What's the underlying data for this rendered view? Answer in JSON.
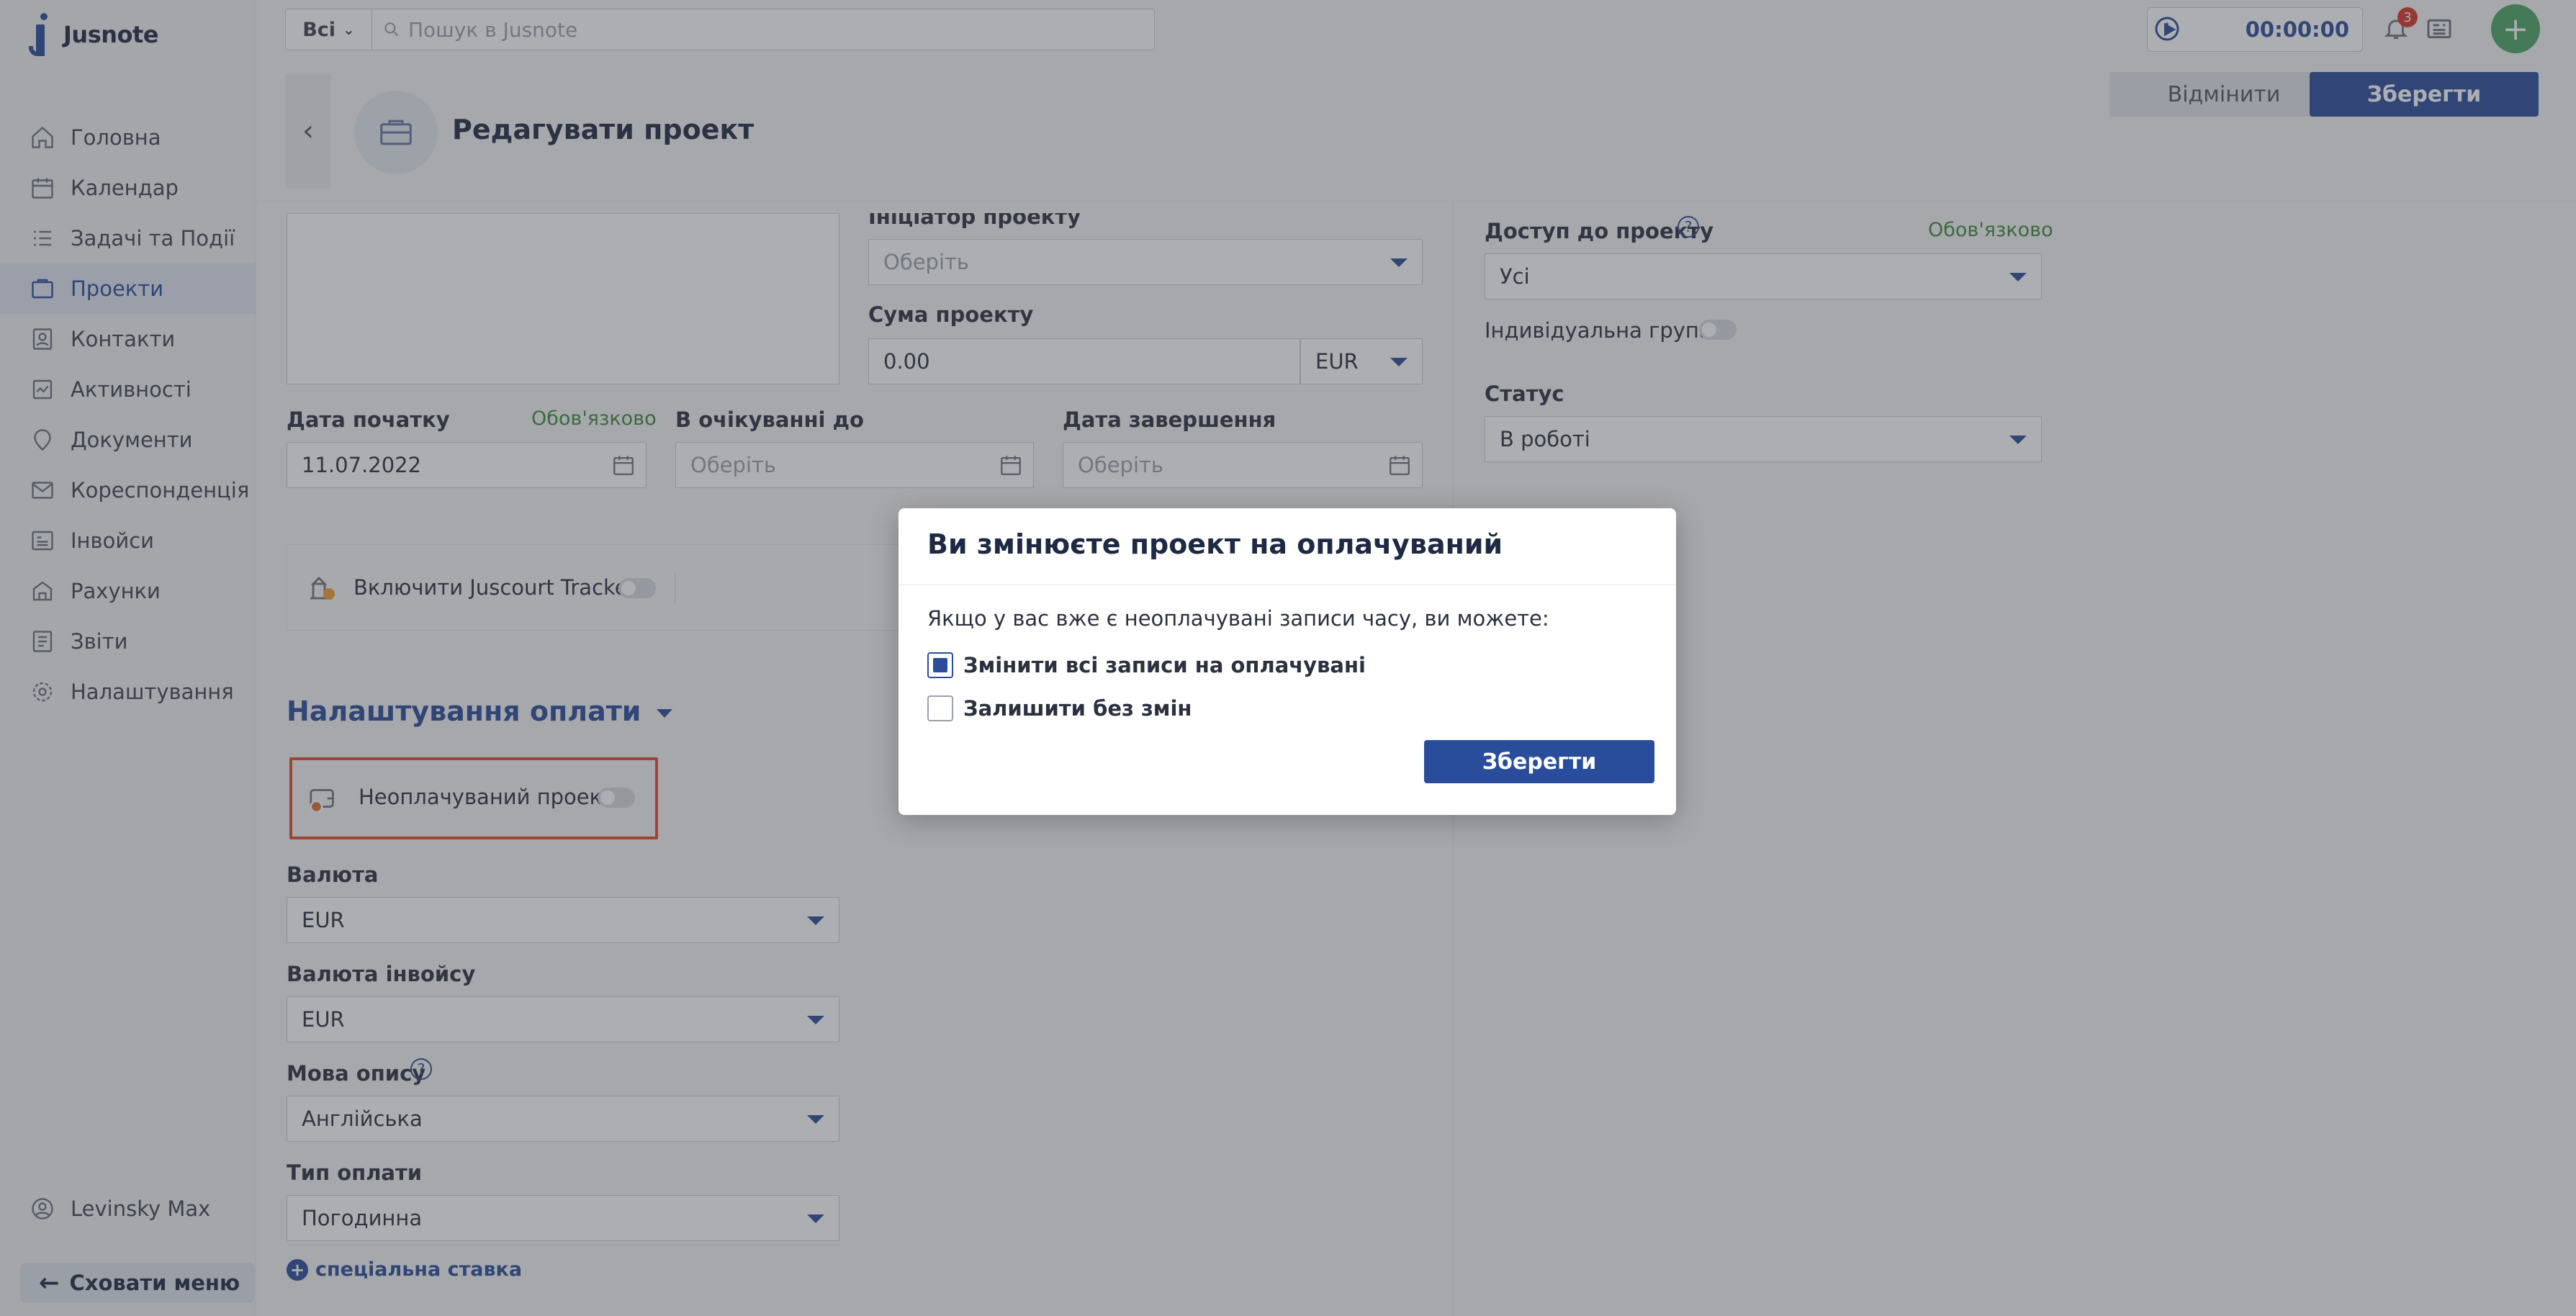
{
  "app": {
    "name": "Jusnote"
  },
  "sidebar": {
    "items": [
      {
        "label": "Головна",
        "icon": "home-icon"
      },
      {
        "label": "Календар",
        "icon": "calendar-icon"
      },
      {
        "label": "Задачі та Події",
        "icon": "tasks-icon"
      },
      {
        "label": "Проекти",
        "icon": "projects-icon",
        "active": true
      },
      {
        "label": "Контакти",
        "icon": "contacts-icon"
      },
      {
        "label": "Активності",
        "icon": "activities-icon"
      },
      {
        "label": "Документи",
        "icon": "documents-icon"
      },
      {
        "label": "Кореспонденція",
        "icon": "correspondence-icon"
      },
      {
        "label": "Інвойси",
        "icon": "invoices-icon"
      },
      {
        "label": "Рахунки",
        "icon": "accounts-icon"
      },
      {
        "label": "Звіти",
        "icon": "reports-icon"
      },
      {
        "label": "Налаштування",
        "icon": "settings-icon"
      }
    ],
    "user": "Levinsky Max",
    "hide_menu": "Сховати меню"
  },
  "topbar": {
    "search_scope": "Всі",
    "search_placeholder": "Пошук в Jusnote",
    "timer": "00:00:00",
    "notifications_count": "3"
  },
  "header": {
    "title": "Редагувати проект",
    "cancel": "Відмінити",
    "save": "Зберегти"
  },
  "form": {
    "initiator_label": "Ініціатор проекту",
    "initiator_placeholder": "Оберіть",
    "amount_label": "Сума проекту",
    "amount_value": "0.00",
    "amount_currency": "EUR",
    "start_date_label": "Дата початку",
    "start_date_required": "Обов'язково",
    "start_date_value": "11.07.2022",
    "pending_label": "В очікуванні до",
    "pending_placeholder": "Оберіть",
    "end_date_label": "Дата завершення",
    "end_date_placeholder": "Оберіть",
    "tracker_label": "Включити Juscourt Tracker",
    "payment_section": "Налаштування оплати",
    "unpaid_label": "Неоплачуваний проект",
    "currency_label": "Валюта",
    "currency_value": "EUR",
    "invoice_currency_label": "Валюта інвойсу",
    "invoice_currency_value": "EUR",
    "description_lang_label": "Мова опису",
    "description_lang_value": "Англійська",
    "payment_type_label": "Тип оплати",
    "payment_type_value": "Погодинна",
    "special_rate": "спеціальна ставка",
    "access_label": "Доступ до проекту",
    "access_required": "Обов'язково",
    "access_value": "Усі",
    "individual_group_label": "Індивідуальна група",
    "status_label": "Статус",
    "status_value": "В роботі"
  },
  "modal": {
    "title": "Ви змінюєте проект на оплачуваний",
    "description": "Якщо у вас вже є неоплачувані записи часу, ви можете:",
    "option_1": "Змінити всі записи на оплачувані",
    "option_2": "Залишити без змін",
    "save": "Зберегти"
  },
  "colors": {
    "primary": "#2a4d9b",
    "required_green": "#3c8a3c",
    "highlight": "#e24b2e",
    "add_button": "#4aa664"
  }
}
